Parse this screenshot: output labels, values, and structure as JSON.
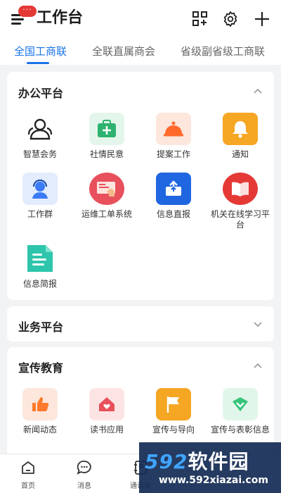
{
  "header": {
    "title": "工作台",
    "badge": "···",
    "icons": [
      "menu-icon",
      "qr-code-icon",
      "gear-icon",
      "plus-icon"
    ]
  },
  "tabs": [
    {
      "label": "全国工商联",
      "active": true
    },
    {
      "label": "全联直属商会",
      "active": false
    },
    {
      "label": "省级副省级工商联",
      "active": false
    }
  ],
  "office": {
    "title": "办公平台",
    "apps": [
      {
        "label": "智慧会务",
        "icon": "people-icon",
        "color": "#ffffff"
      },
      {
        "label": "社情民意",
        "icon": "medical-kit-icon",
        "color": "#2db36f"
      },
      {
        "label": "提案工作",
        "icon": "bell-dome-icon",
        "color": "#ff6a2c"
      },
      {
        "label": "通知",
        "icon": "bell-icon",
        "color": "#f5a623"
      },
      {
        "label": "工作群",
        "icon": "headset-person-icon",
        "color": "#3a7bf7"
      },
      {
        "label": "运维工单系统",
        "icon": "hand-screen-icon",
        "color": "#e8505b"
      },
      {
        "label": "信息直报",
        "icon": "upload-tray-icon",
        "color": "#1f66e0"
      },
      {
        "label": "机关在线学习平台",
        "icon": "book-icon",
        "color": "#e53935"
      },
      {
        "label": "信息简报",
        "icon": "document-icon",
        "color": "#2ec5ad"
      }
    ]
  },
  "business": {
    "title": "业务平台"
  },
  "education": {
    "title": "宣传教育",
    "apps": [
      {
        "label": "新闻动态",
        "icon": "thumbs-up-icon",
        "color": "#ff7a2e"
      },
      {
        "label": "读书应用",
        "icon": "house-heart-icon",
        "color": "#e8505b"
      },
      {
        "label": "宣传与导向",
        "icon": "flag-icon",
        "color": "#f5a623"
      },
      {
        "label": "宣传与表彰信息",
        "icon": "badge-check-icon",
        "color": "#35c37a"
      }
    ]
  },
  "bottom_nav": [
    {
      "label": "首页",
      "icon": "home-icon"
    },
    {
      "label": "消息",
      "icon": "chat-icon"
    },
    {
      "label": "通讯录",
      "icon": "contacts-icon"
    }
  ],
  "watermark": {
    "big_num": "592",
    "big_cn": "软件园",
    "url": "www.592xiazai.com"
  }
}
